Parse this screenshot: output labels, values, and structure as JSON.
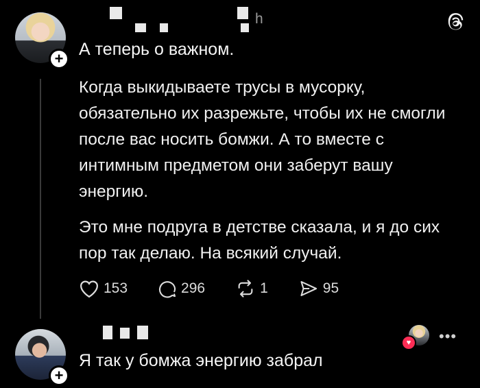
{
  "post": {
    "author_tail": "h",
    "headline": "А теперь о важном.",
    "paragraphs": [
      "Когда выкидываете трусы в мусорку, обязательно их разрежьте, чтобы их не смогли после вас носить бомжи. А то вместе с интимным предметом они заберут вашу энергию.",
      "Это мне подруга в детстве сказала, и я до сих пор так делаю. На всякий случай."
    ],
    "actions": {
      "likes": "153",
      "comments": "296",
      "reposts": "1",
      "shares": "95"
    },
    "icons": {
      "brand": "threads-icon",
      "like": "heart-icon",
      "comment": "comment-bubble-icon",
      "repost": "repost-icon",
      "share": "send-icon"
    }
  },
  "reply": {
    "text": "Я так у бомжа энергию забрал",
    "icons": {
      "more": "more-horizontal-icon",
      "liked_by_author": "heart-icon"
    }
  },
  "colors": {
    "background": "#000000",
    "text": "#f3f3f3",
    "muted": "#9a9a9a",
    "heart_badge": "#ff2d55"
  }
}
